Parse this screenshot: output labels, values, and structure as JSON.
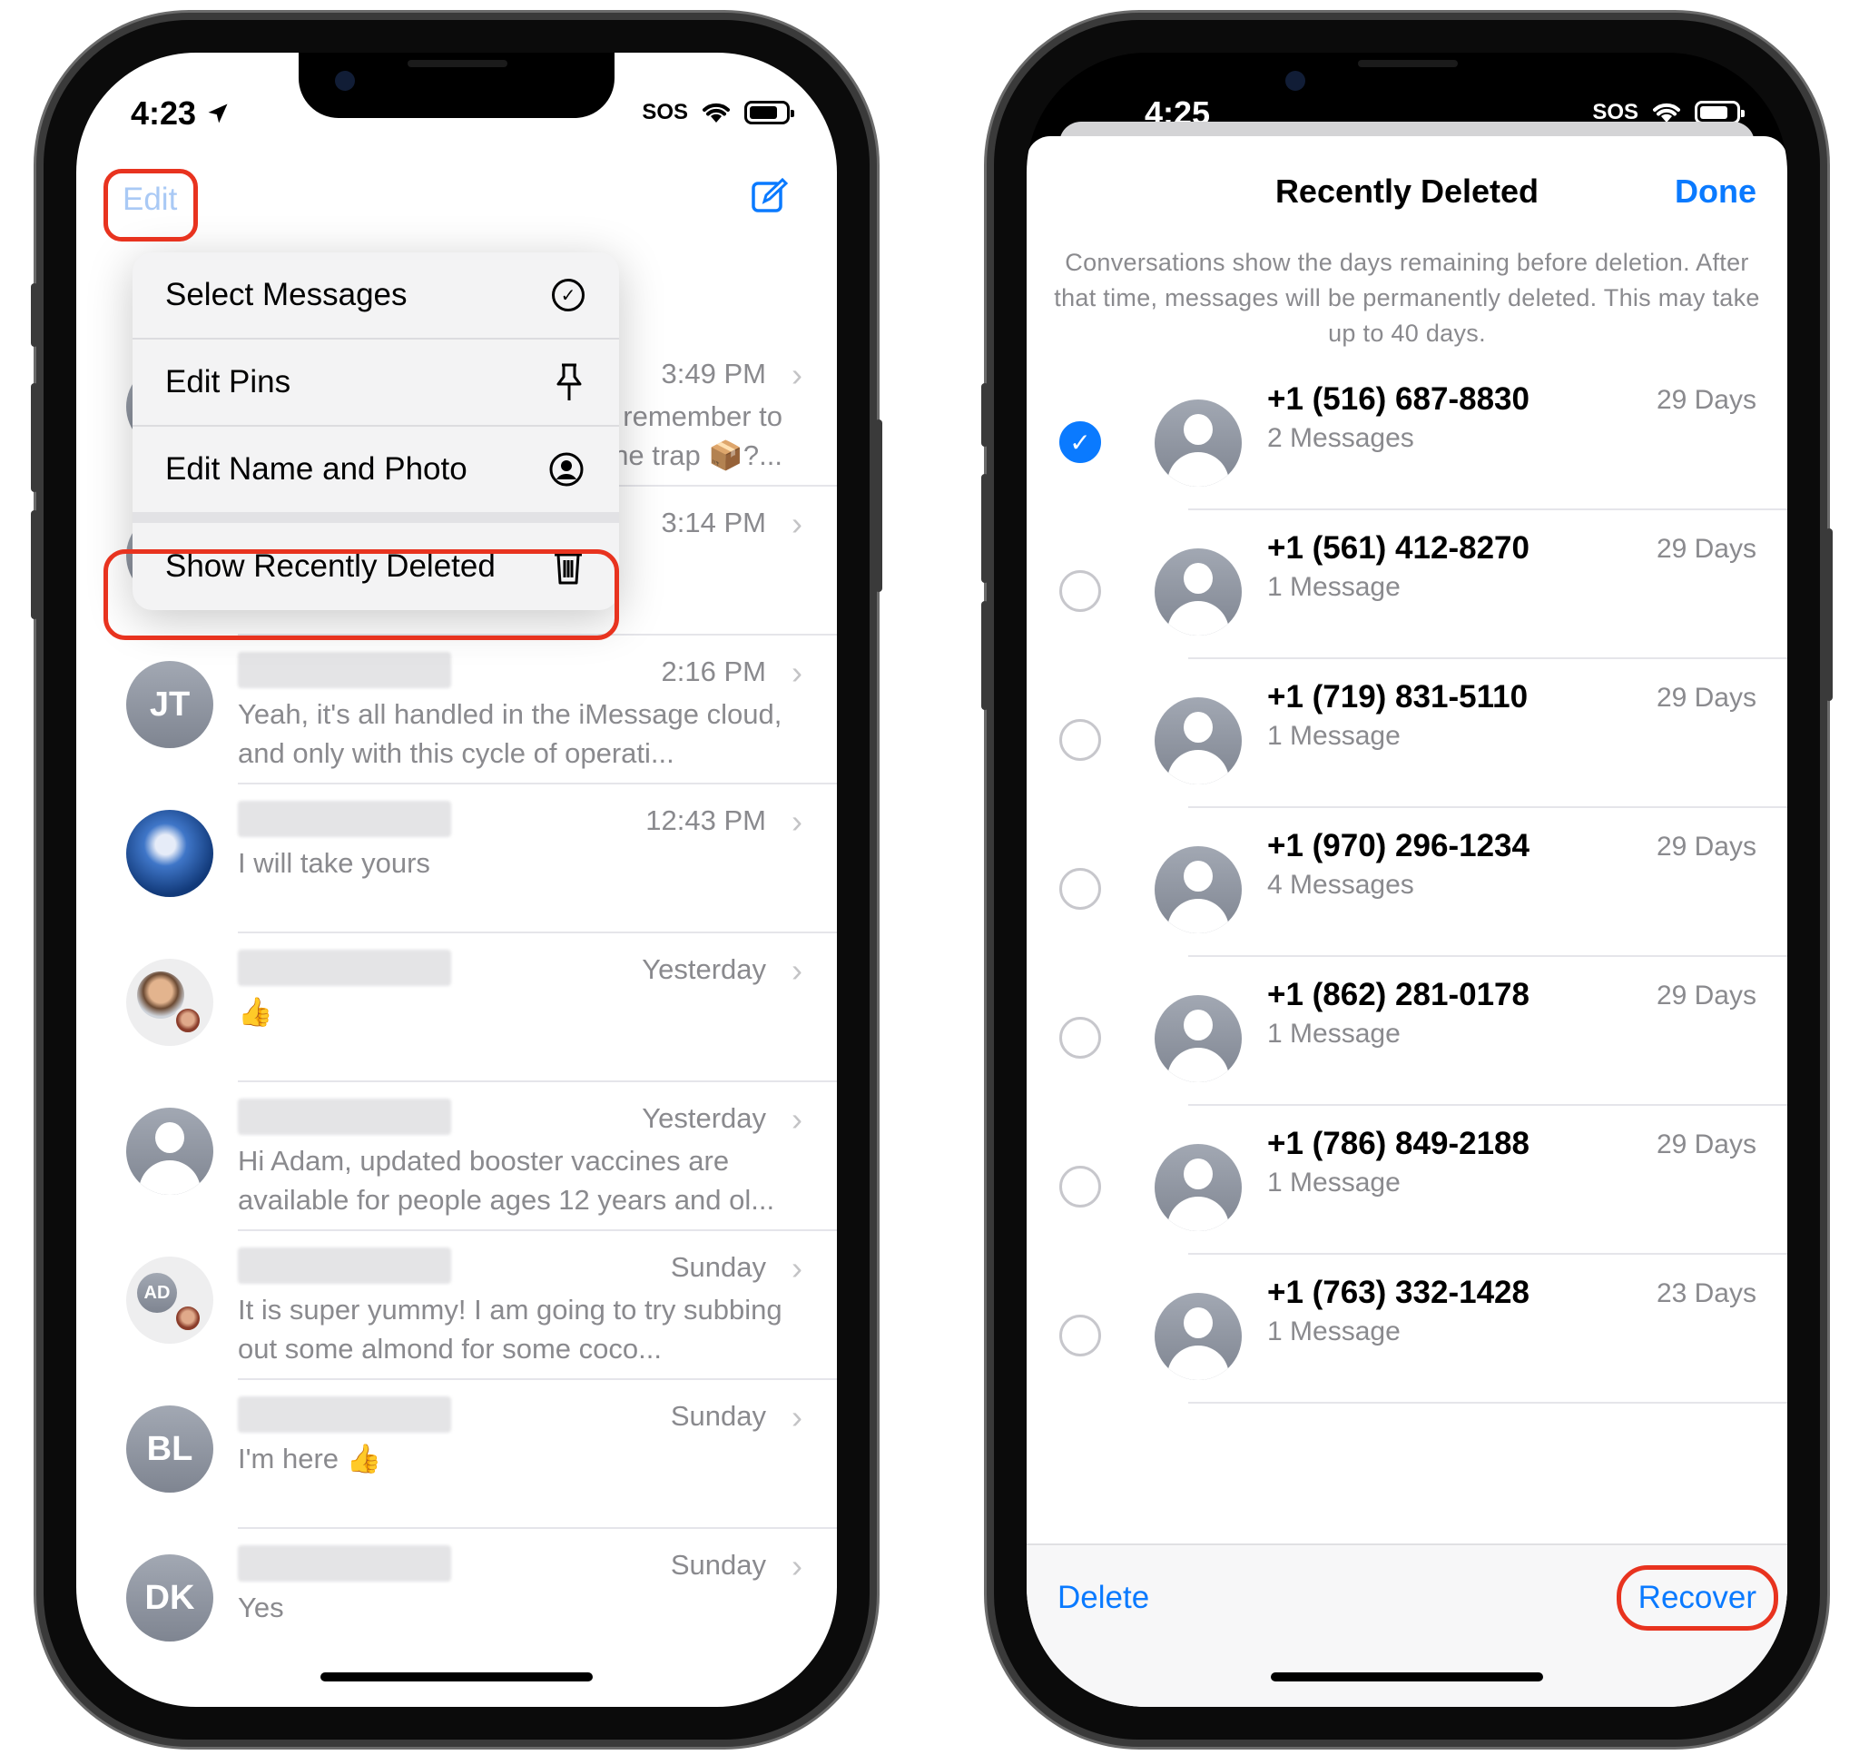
{
  "left": {
    "status_time": "4:23",
    "status_sos": "SOS",
    "edit_label": "Edit",
    "menu": [
      {
        "label": "Select Messages",
        "icon": "checkmark-circle-icon"
      },
      {
        "label": "Edit Pins",
        "icon": "pin-icon"
      },
      {
        "label": "Edit Name and Photo",
        "icon": "person-circle-icon"
      },
      {
        "label": "Show Recently Deleted",
        "icon": "trash-icon"
      }
    ],
    "conversations": [
      {
        "time": "3:49 PM",
        "preview": "you remember to\n the trap 📦?..."
      },
      {
        "time": "3:14 PM",
        "preview": ""
      },
      {
        "initials": "JT",
        "time": "2:16 PM",
        "preview": "Yeah, it's all handled in the iMessage cloud, and only with this cycle of operati..."
      },
      {
        "time": "12:43 PM",
        "preview": "I will take yours"
      },
      {
        "time": "Yesterday",
        "preview": "👍"
      },
      {
        "time": "Yesterday",
        "preview": "Hi Adam, updated booster vaccines are available for people ages 12 years and ol..."
      },
      {
        "initials": "AD",
        "time": "Sunday",
        "preview": "It is super yummy! I am going to try subbing out some almond for some coco..."
      },
      {
        "initials": "BL",
        "time": "Sunday",
        "preview": "I'm here 👍"
      },
      {
        "initials": "DK",
        "time": "Sunday",
        "preview": "Yes"
      }
    ]
  },
  "right": {
    "status_time": "4:25",
    "status_sos": "SOS",
    "title": "Recently Deleted",
    "done_label": "Done",
    "note": "Conversations show the days remaining before deletion. After that time, messages will be permanently deleted. This may take up to 40 days.",
    "items": [
      {
        "phone": "+1 (516) 687-8830",
        "count": "2 Messages",
        "days": "29 Days",
        "selected": true
      },
      {
        "phone": "+1 (561) 412-8270",
        "count": "1 Message",
        "days": "29 Days",
        "selected": false
      },
      {
        "phone": "+1 (719) 831-5110",
        "count": "1 Message",
        "days": "29 Days",
        "selected": false
      },
      {
        "phone": "+1 (970) 296-1234",
        "count": "4 Messages",
        "days": "29 Days",
        "selected": false
      },
      {
        "phone": "+1 (862) 281-0178",
        "count": "1 Message",
        "days": "29 Days",
        "selected": false
      },
      {
        "phone": "+1 (786) 849-2188",
        "count": "1 Message",
        "days": "29 Days",
        "selected": false
      },
      {
        "phone": "+1 (763) 332-1428",
        "count": "1 Message",
        "days": "23 Days",
        "selected": false
      }
    ],
    "delete_label": "Delete",
    "recover_label": "Recover",
    "checkmark": "✓"
  },
  "colors": {
    "accent": "#0a7aff",
    "highlight_ring": "#e8331f",
    "secondary_text": "#8a8a8e"
  }
}
